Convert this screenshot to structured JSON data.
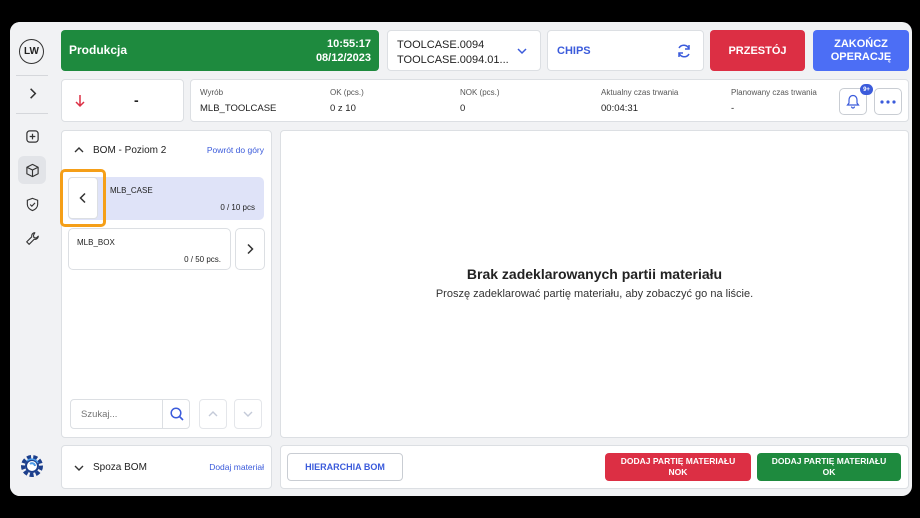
{
  "user": {
    "initials": "LW"
  },
  "status": {
    "label": "Produkcja",
    "time": "10:55:17",
    "date": "08/12/2023",
    "color": "#1e8a3e"
  },
  "order": {
    "line1": "TOOLCASE.0094",
    "line2": "TOOLCASE.0094.01..."
  },
  "resource": {
    "name": "CHIPS"
  },
  "buttons": {
    "downtime": "PRZESTÓJ",
    "finish_line1": "ZAKOŃCZ",
    "finish_line2": "OPERACJĘ"
  },
  "trend": {
    "value": "-"
  },
  "info": {
    "product_label": "Wyrób",
    "product_value": "MLB_TOOLCASE",
    "ok_label": "OK (pcs.)",
    "ok_value": "0 z 10",
    "nok_label": "NOK (pcs.)",
    "nok_value": "0",
    "actual_label": "Aktualny czas trwania",
    "actual_value": "00:04:31",
    "planned_label": "Planowany czas trwania",
    "planned_value": "-"
  },
  "notifications": {
    "badge": "9+"
  },
  "bom": {
    "title": "BOM - Poziom 2",
    "back_link": "Powrót do góry",
    "items": [
      {
        "name": "MLB_CASE",
        "qty": "0 / 10 pcs"
      },
      {
        "name": "MLB_BOX",
        "qty": "0 / 50 pcs."
      }
    ],
    "search_placeholder": "Szukaj..."
  },
  "empty": {
    "title": "Brak zadeklarowanych partii materiału",
    "subtitle": "Proszę zadeklarować partię materiału, aby zobaczyć go na liście."
  },
  "outside_bom": {
    "title": "Spoza BOM",
    "link": "Dodaj materiał"
  },
  "actions": {
    "hierarchy": "HIERARCHIA BOM",
    "add_nok_line1": "DODAJ PARTIĘ MATERIAŁU",
    "add_nok_line2": "NOK",
    "add_ok_line1": "DODAJ PARTIĘ MATERIAŁU",
    "add_ok_line2": "OK"
  },
  "colors": {
    "accent": "#3b5bdb",
    "danger": "#dc2f44",
    "success": "#1e8a3e",
    "highlight": "#f59f18",
    "selected": "#dfe3f8"
  }
}
